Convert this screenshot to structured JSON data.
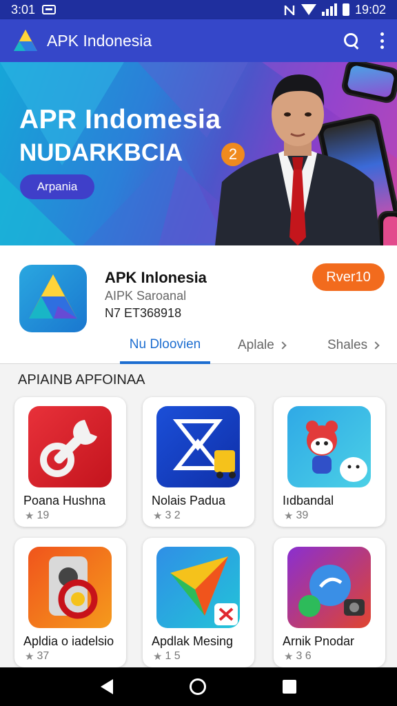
{
  "status_bar": {
    "time": "3:01",
    "clock": "19:02"
  },
  "app_bar": {
    "title": "APK Indonesia"
  },
  "banner": {
    "title": "APR Indomesia",
    "subtitle": "NUDARKBCIA",
    "button_label": "Arpania",
    "badge": "2"
  },
  "app_card": {
    "name": "APK Inlonesia",
    "publisher": "AIPK Saroanal",
    "version": "N7 ET368918",
    "install_label": "Rver10",
    "tabs": [
      {
        "label": "Nu Dloovien"
      },
      {
        "label": "Aplale"
      },
      {
        "label": "Shales"
      }
    ]
  },
  "section": {
    "title": "APIAINB APFOINAA",
    "apps": [
      {
        "name": "Poana Hushna",
        "rating": "19"
      },
      {
        "name": "Nolais Padua",
        "rating": "3 2"
      },
      {
        "name": "Iıdbandal",
        "rating": "39"
      },
      {
        "name": "Apldia o iadelsio",
        "rating": "37"
      },
      {
        "name": "Apdlak Mesing",
        "rating": "1 5"
      },
      {
        "name": "Arnik Pnodar",
        "rating": "3 6"
      }
    ]
  },
  "icons": {
    "star": "★",
    "colors": {
      "primary": "#3547c9",
      "accent": "#f26b1d",
      "tab_active": "#1c6dd0"
    }
  }
}
